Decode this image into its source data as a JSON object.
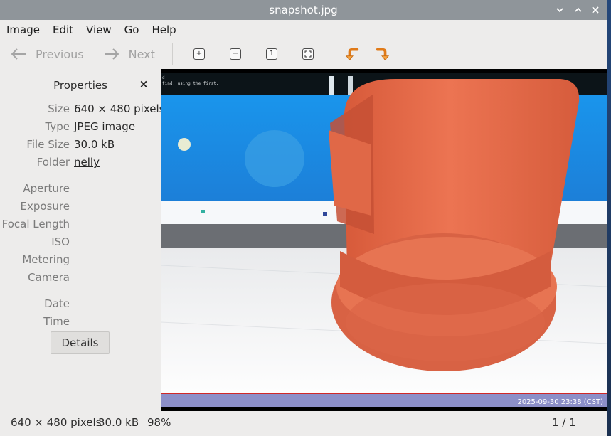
{
  "window": {
    "title": "snapshot.jpg"
  },
  "menubar": {
    "items": [
      "Image",
      "Edit",
      "View",
      "Go",
      "Help"
    ]
  },
  "toolbar": {
    "previous_label": "Previous",
    "next_label": "Next",
    "icons": [
      "zoom-in-icon",
      "zoom-out-icon",
      "zoom-original-icon",
      "zoom-fit-icon",
      "rotate-left-icon",
      "rotate-right-icon"
    ]
  },
  "sidebar": {
    "title": "Properties",
    "close": "×",
    "props": [
      {
        "key": "Size",
        "value": "640 × 480 pixels"
      },
      {
        "key": "Type",
        "value": "JPEG image"
      },
      {
        "key": "File Size",
        "value": "30.0 kB"
      },
      {
        "key": "Folder",
        "value": "nelly"
      }
    ],
    "exif": [
      {
        "key": "Aperture",
        "value": ""
      },
      {
        "key": "Exposure",
        "value": ""
      },
      {
        "key": "Focal Length",
        "value": ""
      },
      {
        "key": "ISO",
        "value": ""
      },
      {
        "key": "Metering",
        "value": ""
      },
      {
        "key": "Camera",
        "value": ""
      }
    ],
    "datetime": [
      {
        "key": "Date",
        "value": ""
      },
      {
        "key": "Time",
        "value": ""
      }
    ],
    "details_label": "Details"
  },
  "photo": {
    "screen_text_1": "d",
    "screen_text_2": "find, using the first.",
    "screen_text_3": "...",
    "timestamp": "2025-09-30 23:38 (CST)"
  },
  "statusbar": {
    "dimensions": "640 × 480 pixels",
    "filesize": "30.0 kB",
    "zoom": "98%",
    "position": "1 / 1"
  },
  "colors": {
    "titlebar": "#8f959a",
    "accent_orange": "#f0862a",
    "object": "#e86a4a",
    "screen_blue": "#1e8fe6",
    "timestamp_bar": "#8c8fc8"
  }
}
